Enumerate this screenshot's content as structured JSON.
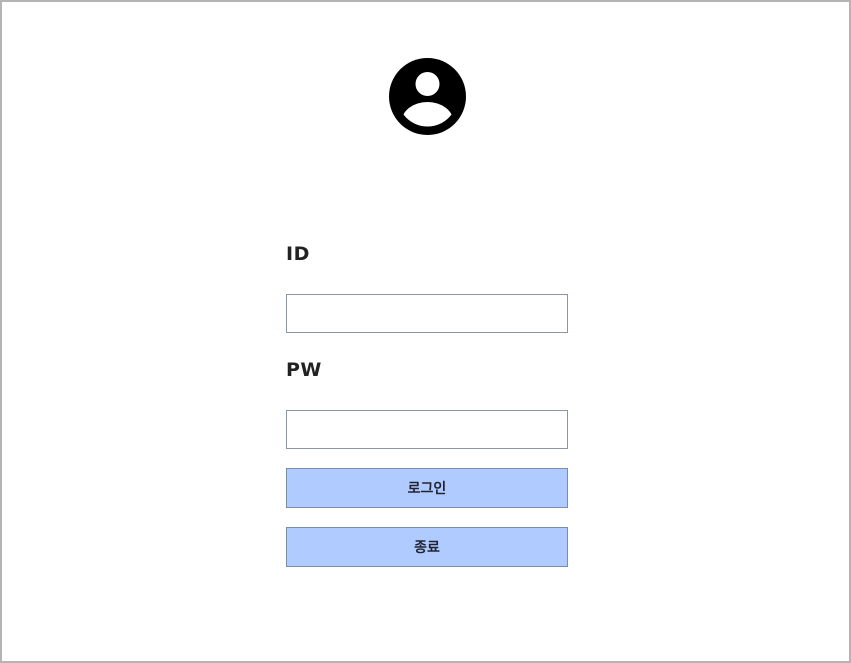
{
  "avatar": {
    "icon": "user-circle-icon",
    "color": "#000000"
  },
  "form": {
    "id_label": "ID",
    "id_value": "",
    "id_placeholder": "",
    "pw_label": "PW",
    "pw_value": "",
    "pw_placeholder": ""
  },
  "buttons": {
    "login_label": "로그인",
    "exit_label": "종료"
  },
  "colors": {
    "button_bg": "#b0cbff",
    "input_border": "#8a96a3",
    "window_border": "#b4b4b4"
  }
}
